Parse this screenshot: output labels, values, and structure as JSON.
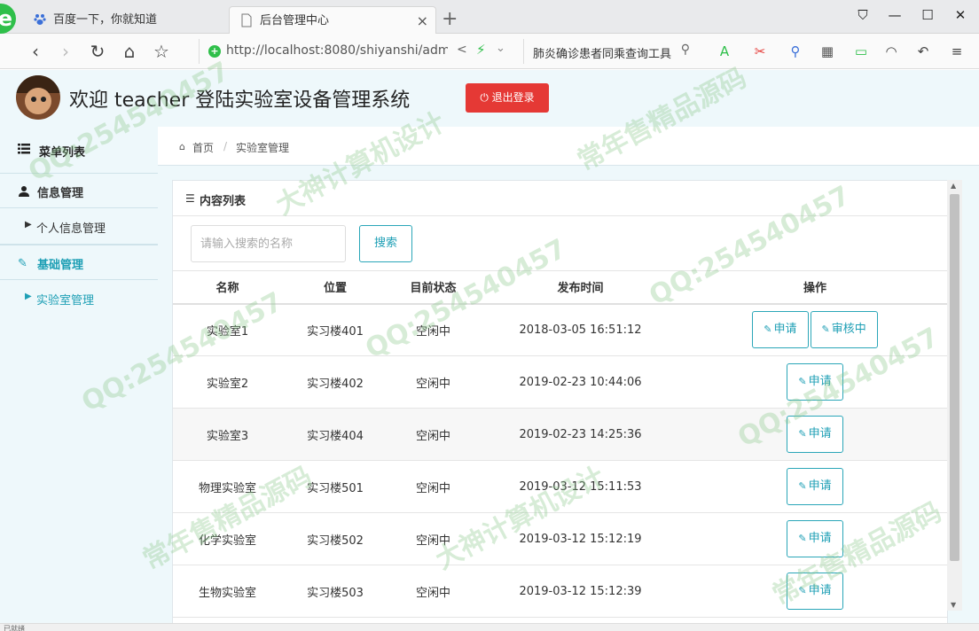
{
  "browser": {
    "tabs": [
      {
        "label": "百度一下，你就知道",
        "active": false
      },
      {
        "label": "后台管理中心",
        "active": true
      }
    ],
    "url": "http://localhost:8080/shiyanshi/admi",
    "search_text": "肺炎确诊患者同乘查询工具",
    "status_text": "已就绪"
  },
  "header": {
    "welcome": "欢迎 teacher 登陆实验室设备管理系统",
    "logout_label": "退出登录"
  },
  "sidebar": {
    "title": "菜单列表",
    "groups": [
      {
        "label": "信息管理",
        "items": [
          {
            "label": "个人信息管理",
            "active": false
          }
        ]
      },
      {
        "label": "基础管理",
        "items": [
          {
            "label": "实验室管理",
            "active": true
          }
        ]
      }
    ]
  },
  "breadcrumb": {
    "home": "首页",
    "current": "实验室管理"
  },
  "panel": {
    "title": "内容列表",
    "search_placeholder": "请输入搜索的名称",
    "search_button": "搜索"
  },
  "table": {
    "headers": [
      "名称",
      "位置",
      "目前状态",
      "发布时间",
      "操作"
    ],
    "rows": [
      {
        "name": "实验室1",
        "location": "实习楼401",
        "status": "空闲中",
        "time": "2018-03-05 16:51:12",
        "actions": [
          "申请",
          "审核中"
        ]
      },
      {
        "name": "实验室2",
        "location": "实习楼402",
        "status": "空闲中",
        "time": "2019-02-23 10:44:06",
        "actions": [
          "申请"
        ]
      },
      {
        "name": "实验室3",
        "location": "实习楼404",
        "status": "空闲中",
        "time": "2019-02-23 14:25:36",
        "actions": [
          "申请"
        ]
      },
      {
        "name": "物理实验室",
        "location": "实习楼501",
        "status": "空闲中",
        "time": "2019-03-12 15:11:53",
        "actions": [
          "申请"
        ]
      },
      {
        "name": "化学实验室",
        "location": "实习楼502",
        "status": "空闲中",
        "time": "2019-03-12 15:12:19",
        "actions": [
          "申请"
        ]
      },
      {
        "name": "生物实验室",
        "location": "实习楼503",
        "status": "空闲中",
        "time": "2019-03-12 15:12:39",
        "actions": [
          "申请"
        ]
      }
    ]
  },
  "watermarks": [
    "QQ:254540457",
    "大神计算机设计",
    "常年售精品源码"
  ],
  "colors": {
    "accent": "#2aa6b8",
    "logout": "#e53935",
    "bg": "#eef8fb"
  }
}
